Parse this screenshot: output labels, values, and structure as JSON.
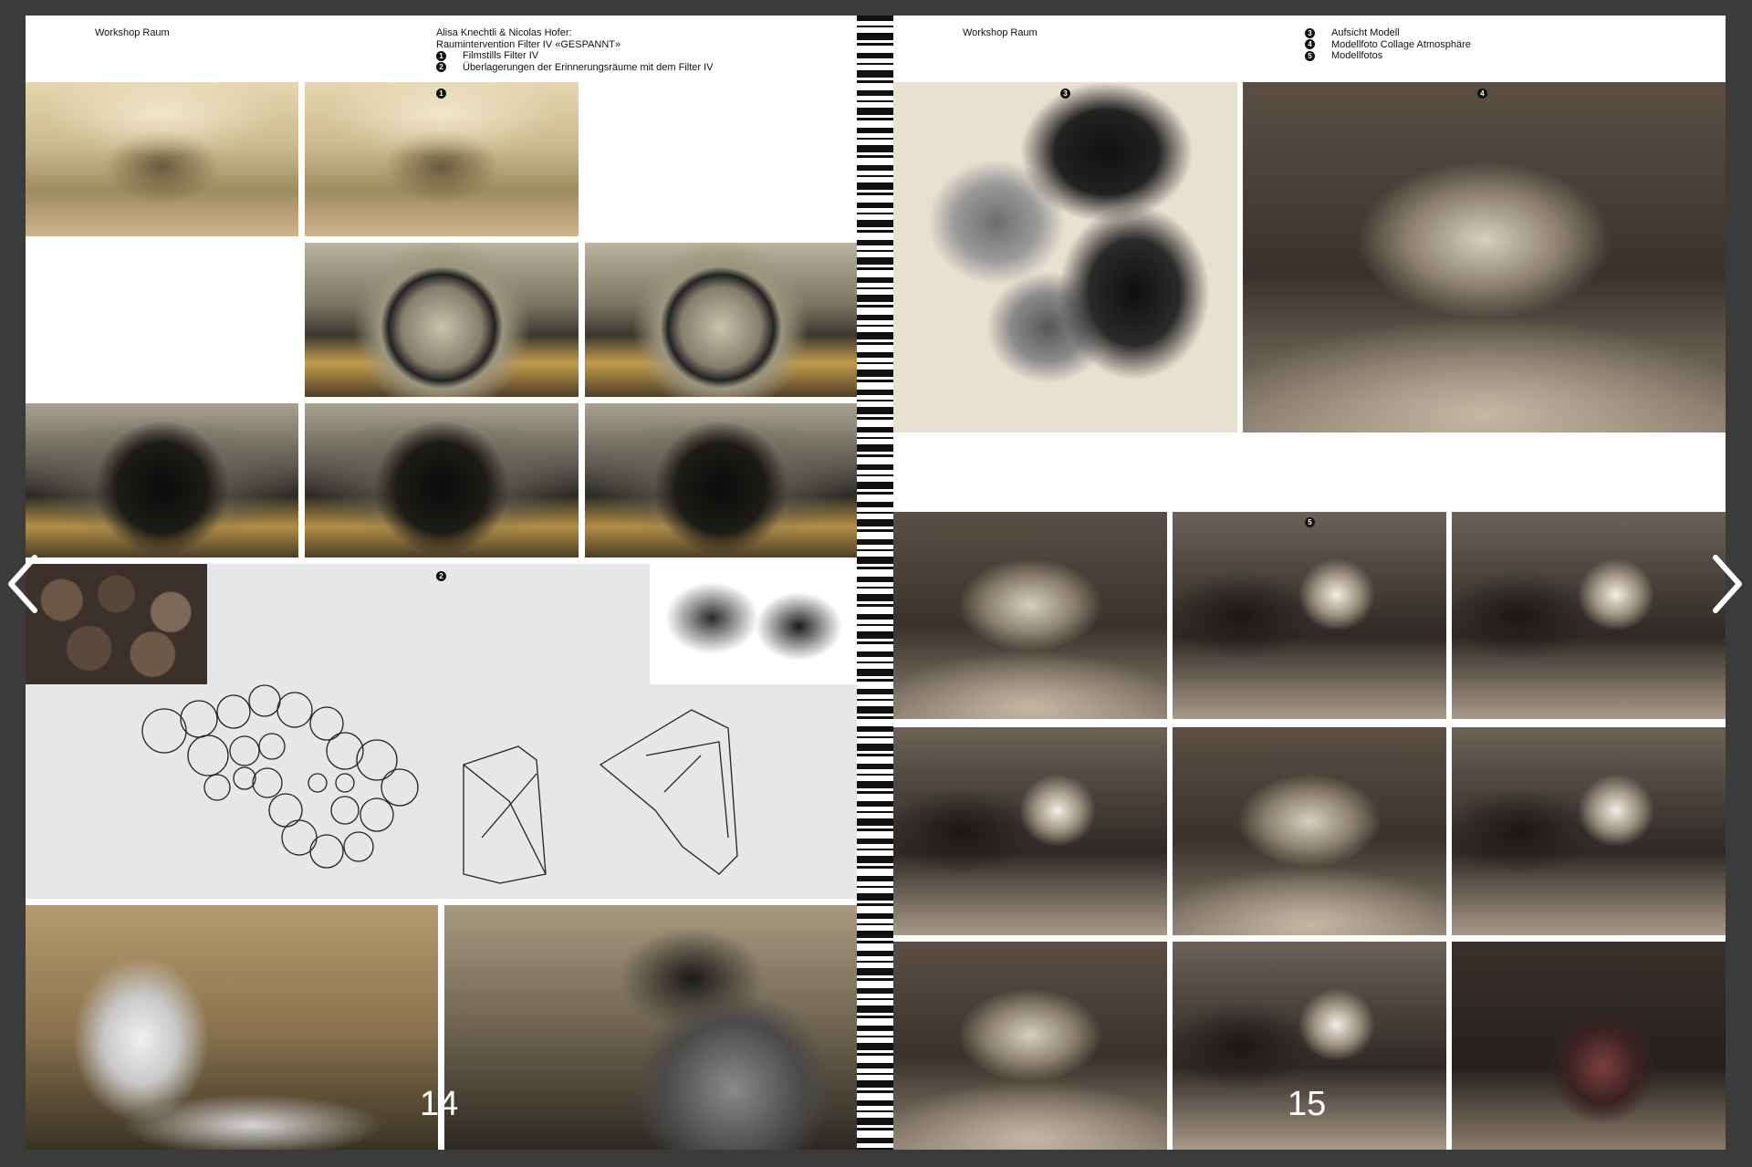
{
  "left_page": {
    "header_left": "Workshop Raum",
    "header_title": "Alisa Knechtli & Nicolas Hofer:",
    "header_subtitle": "Raumintervention Filter IV «GESPANNT»",
    "items": [
      {
        "num": "1",
        "text": "Filmstills Filter IV"
      },
      {
        "num": "2",
        "text": "Überlagerungen der Erinnerungsräume mit dem Filter IV"
      }
    ],
    "markers": [
      "1",
      "2"
    ],
    "page_number": "14"
  },
  "right_page": {
    "header_left": "Workshop Raum",
    "items": [
      {
        "num": "3",
        "text": "Aufsicht Modell"
      },
      {
        "num": "4",
        "text": "Modellfoto Collage Atmosphäre"
      },
      {
        "num": "5",
        "text": "Modellfotos"
      }
    ],
    "markers": [
      "3",
      "4",
      "5"
    ],
    "page_number": "15"
  },
  "navigation": {
    "prev_icon": "chevron-left-icon",
    "next_icon": "chevron-right-icon"
  }
}
